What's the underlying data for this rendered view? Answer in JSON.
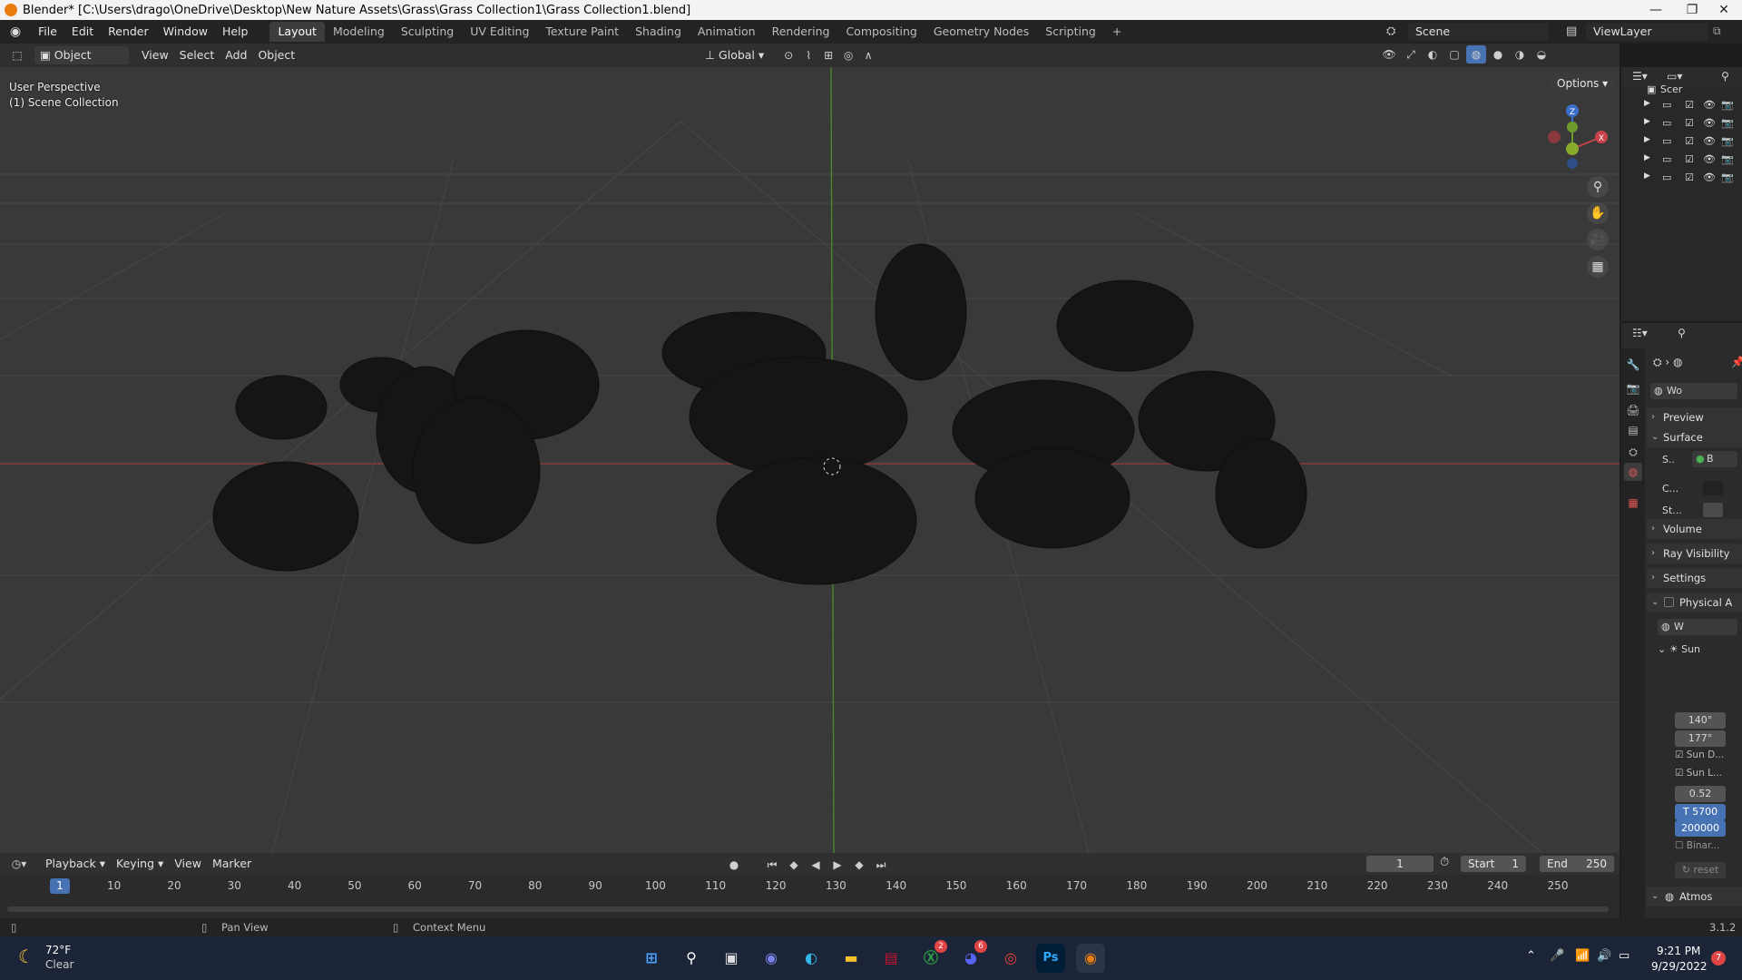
{
  "titlebar": {
    "title": "Blender* [C:\\Users\\drago\\OneDrive\\Desktop\\New Nature Assets\\Grass\\Grass Collection1\\Grass Collection1.blend]",
    "minimize": "—",
    "maximize": "❐",
    "close": "✕"
  },
  "menu": [
    "File",
    "Edit",
    "Render",
    "Window",
    "Help"
  ],
  "workspaces": [
    "Layout",
    "Modeling",
    "Sculpting",
    "UV Editing",
    "Texture Paint",
    "Shading",
    "Animation",
    "Rendering",
    "Compositing",
    "Geometry Nodes",
    "Scripting"
  ],
  "workspace_add": "+",
  "scene": {
    "name": "Scene",
    "view_layer": "ViewLayer"
  },
  "header3d": {
    "mode": "Object Mode",
    "view": "View",
    "select": "Select",
    "add": "Add",
    "object": "Object",
    "orientation": "Global",
    "options": "Options"
  },
  "viewport": {
    "perspective": "User Perspective",
    "collection": "(1) Scene Collection"
  },
  "gizmo": {
    "z": "Z",
    "x": "X"
  },
  "outliner": {
    "header": "Scer",
    "row_count": 5
  },
  "properties": {
    "world_name": "Wo",
    "panels": {
      "preview": "Preview",
      "surface": "Surface",
      "surface_field": "S..",
      "surface_value": "B",
      "color": "C...",
      "strength": "St...",
      "volume": "Volume",
      "ray_visibility": "Ray Visibility",
      "settings": "Settings",
      "physical": "Physical A",
      "world_sub": "W",
      "sun": "Sun",
      "atmos": "Atmos"
    },
    "values": {
      "v1": "140°",
      "v2": "177°",
      "sun_d": "Sun D...",
      "sun_l": "Sun L...",
      "v3": "0.52",
      "temp": "T  5700",
      "v4": "200000",
      "binar": "Binar...",
      "reset": "reset"
    }
  },
  "timeline": {
    "playback": "Playback",
    "keying": "Keying",
    "view": "View",
    "marker": "Marker",
    "current": "1",
    "start_label": "Start",
    "start": "1",
    "end_label": "End",
    "end": "250",
    "ticks": [
      "1",
      "10",
      "20",
      "30",
      "40",
      "50",
      "60",
      "70",
      "80",
      "90",
      "100",
      "110",
      "120",
      "130",
      "140",
      "150",
      "160",
      "170",
      "180",
      "190",
      "200",
      "210",
      "220",
      "230",
      "240",
      "250"
    ]
  },
  "status": {
    "pan": "Pan View",
    "context": "Context Menu",
    "version": "3.1.2"
  },
  "taskbar": {
    "temp": "72°F",
    "weather": "Clear",
    "time": "9:21 PM",
    "date": "9/29/2022",
    "notif": "7",
    "badge_xbox": "2",
    "badge_discord": "6"
  }
}
